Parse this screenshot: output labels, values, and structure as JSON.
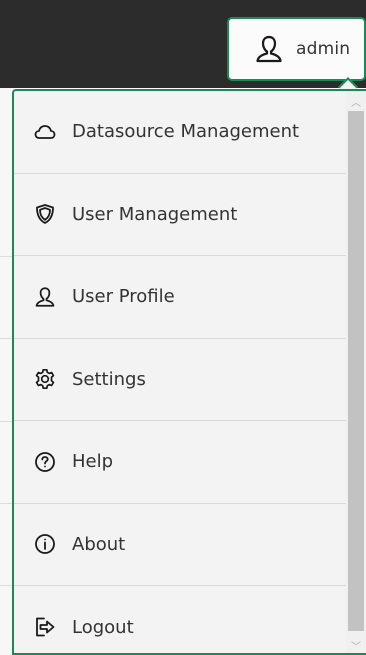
{
  "colors": {
    "accent": "#1c8a57",
    "topbar": "#2c2c2c",
    "menu_background": "#f3f3f3",
    "scroll_thumb": "#c2c2c2"
  },
  "header": {
    "user_button": {
      "icon": "user-icon",
      "label": "admin"
    }
  },
  "menu": {
    "items": [
      {
        "icon": "cloud-icon",
        "label": "Datasource Management"
      },
      {
        "icon": "shield-icon",
        "label": "User Management"
      },
      {
        "icon": "user-icon",
        "label": "User Profile"
      },
      {
        "icon": "gear-icon",
        "label": "Settings"
      },
      {
        "icon": "help-icon",
        "label": "Help"
      },
      {
        "icon": "info-icon",
        "label": "About"
      },
      {
        "icon": "logout-icon",
        "label": "Logout"
      }
    ]
  },
  "scrollbar": {
    "up_arrow": "︿",
    "down_arrow": "﹀"
  }
}
